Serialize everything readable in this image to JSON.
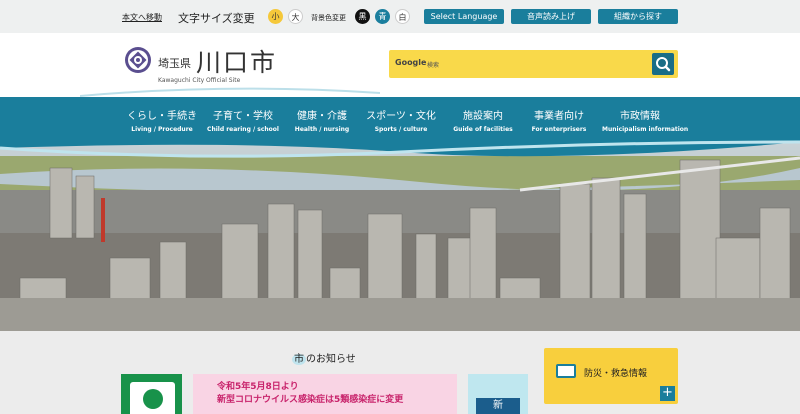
{
  "topbar": {
    "skip_link": "本文へ移動",
    "font_size_label": "文字サイズ変更",
    "font_small": "小",
    "font_large": "大",
    "bg_label": "背景色変更",
    "bg_black": "黒",
    "bg_blue": "青",
    "bg_white": "白",
    "select_language": "Select Language",
    "voice_read": "音声読み上げ",
    "org_search": "組織から探す"
  },
  "header": {
    "prefecture": "埼玉県",
    "city_name": "川口市",
    "city_english": "Kawaguchi City Official Site",
    "search_brand": "Google",
    "search_placeholder": "検索"
  },
  "nav": {
    "items": [
      {
        "jp": "くらし・手続き",
        "en": "Living / Procedure"
      },
      {
        "jp": "子育て・学校",
        "en": "Child rearing / school"
      },
      {
        "jp": "健康・介護",
        "en": "Health / nursing"
      },
      {
        "jp": "スポーツ・文化",
        "en": "Sports / culture"
      },
      {
        "jp": "施設案内",
        "en": "Guide of facilities"
      },
      {
        "jp": "事業者向け",
        "en": "For enterprisers"
      },
      {
        "jp": "市政情報",
        "en": "Municipalism information"
      }
    ]
  },
  "news": {
    "heading_first": "市",
    "heading_rest": "のお知らせ",
    "banner_line1": "令和5年5月8日より",
    "banner_line2": "新型コロナウイルス感染症は5類感染症に変更",
    "banner_right_text": "新"
  },
  "disaster": {
    "label": "防災・救急情報",
    "plus": "+"
  },
  "colors": {
    "brand_teal": "#1a7e9c",
    "accent_yellow": "#f9d94a",
    "banner_pink": "#f9d4e4"
  }
}
